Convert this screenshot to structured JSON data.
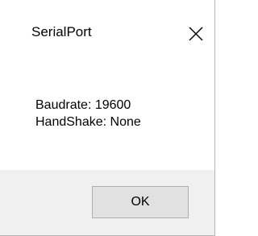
{
  "dialog": {
    "title": "SerialPort",
    "close_icon": "close-icon",
    "message_lines": [
      "Baudrate: 19600",
      "HandShake: None"
    ],
    "ok_label": "OK"
  },
  "colors": {
    "background": "#ffffff",
    "footer_background": "#f0f0f0",
    "button_background": "#e1e1e1",
    "button_border": "#adadad",
    "text": "#000000"
  }
}
